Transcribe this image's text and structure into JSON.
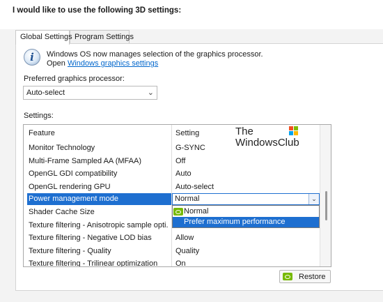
{
  "heading": "I would like to use the following 3D settings:",
  "tabs": [
    {
      "label": "Global Settings",
      "active": true
    },
    {
      "label": "Program Settings",
      "active": false
    }
  ],
  "info": {
    "line1": "Windows OS now manages selection of the graphics processor.",
    "line2_prefix": "Open",
    "link": "Windows graphics settings"
  },
  "preferred_processor": {
    "label": "Preferred graphics processor:",
    "value": "Auto-select"
  },
  "settings": {
    "label": "Settings:",
    "columns": [
      "Feature",
      "Setting"
    ],
    "rows": [
      {
        "feature": "Monitor Technology",
        "setting": "G-SYNC"
      },
      {
        "feature": "Multi-Frame Sampled AA (MFAA)",
        "setting": "Off"
      },
      {
        "feature": "OpenGL GDI compatibility",
        "setting": "Auto"
      },
      {
        "feature": "OpenGL rendering GPU",
        "setting": "Auto-select"
      },
      {
        "feature": "Power management mode",
        "setting": "Normal"
      },
      {
        "feature": "Shader Cache Size",
        "setting": ""
      },
      {
        "feature": "Texture filtering - Anisotropic sample opti...",
        "setting": ""
      },
      {
        "feature": "Texture filtering - Negative LOD bias",
        "setting": "Allow"
      },
      {
        "feature": "Texture filtering - Quality",
        "setting": "Quality"
      },
      {
        "feature": "Texture filtering - Trilinear optimization",
        "setting": "On"
      }
    ],
    "dropdown_options": [
      "Normal",
      "Prefer maximum performance"
    ],
    "highlighted_option": "Prefer maximum performance"
  },
  "watermark": {
    "line1": "The",
    "line2": "WindowsClub"
  },
  "restore_button": "Restore",
  "colors": {
    "selection": "#1e6fd0",
    "link": "#0066cc",
    "nvidia_green": "#76b900"
  }
}
